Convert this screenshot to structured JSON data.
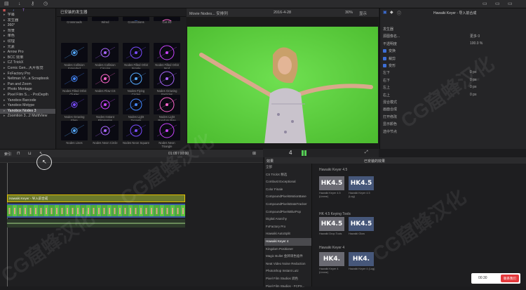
{
  "topbar": {
    "icons": [
      "bars-icon",
      "check-icon",
      "key-icon",
      "clock-icon"
    ],
    "right_icons": [
      "window-icon",
      "window-icon"
    ]
  },
  "sidebar": {
    "items": [
      {
        "pre": "",
        "label": "字幕"
      },
      {
        "pre": "",
        "label": "发生器"
      },
      {
        "pre": "",
        "label": "360°"
      },
      {
        "pre": "",
        "label": "背景"
      },
      {
        "pre": "",
        "label": "单色"
      },
      {
        "pre": "",
        "label": "纹理"
      },
      {
        "pre": "",
        "label": "元素"
      },
      {
        "pre": "",
        "label": "Arrow Pro"
      },
      {
        "pre": "",
        "label": "BCC 效果"
      },
      {
        "pre": "",
        "label": "CZ TrickX"
      },
      {
        "pre": "",
        "label": "Comic Gen...大片视觉"
      },
      {
        "pre": "",
        "label": "FxFactory Pro"
      },
      {
        "pre": "",
        "label": "Neltman VI...a Scrapbook"
      },
      {
        "pre": "",
        "label": "Pan and Zoom"
      },
      {
        "pre": "",
        "label": "Photo Montage"
      },
      {
        "pre": "",
        "label": "Pixel Film S... - ProDepth"
      },
      {
        "pre": "",
        "label": "Yanobox Barcode"
      },
      {
        "pre": "",
        "label": "Yanobox Motype"
      },
      {
        "pre": "",
        "label": "Yanobox Nodes 3"
      },
      {
        "pre": "",
        "label": "Zoomtion 3...2 MultiView"
      }
    ],
    "selected_index": 18
  },
  "browser": {
    "title": "已安装的发生器",
    "thumbs": [
      "Crossroads",
      "Wired",
      "Connections",
      "Cat 3D",
      "Nodes Collision Extended",
      "Nodes Collision Circular",
      "Nodes Filled Orbit Simple",
      "Nodes Filled Orbit Mod",
      "Nodes Filled Orbit Cluster",
      "Nodes Flow CS",
      "Nodes Flying Circles",
      "Nodes Growing Particles",
      "Nodes Growing Flare",
      "Nodes Instant Elimination",
      "Nodes Light Tunnels",
      "Nodes Light Random Rise",
      "Nodes Lines",
      "Nodes Neon Circle",
      "Nodes Neon Square",
      "Nodes Neon Triangle"
    ]
  },
  "viewer": {
    "title": "Movie Nodes... 安排列",
    "date": "2016-4-28",
    "zoom": "30%",
    "display": "显示"
  },
  "viewer_ctrl": {
    "timecode": "4"
  },
  "inspector": {
    "header": "Hawaiki Keyer - 导入前合成",
    "rows": [
      {
        "label": "发生器",
        "value": ""
      },
      {
        "label": "源图像名...",
        "value": "更多 0"
      },
      {
        "label": "不透明度",
        "value": "100.0 %"
      },
      {
        "label": "变换",
        "value": "",
        "checked": true
      },
      {
        "label": "裁剪",
        "value": "",
        "checked": true
      },
      {
        "label": "变形",
        "value": "",
        "checked": true
      },
      {
        "label": "左下",
        "value": "0 px"
      },
      {
        "label": "右下",
        "value": "0 px"
      },
      {
        "label": "左上",
        "value": "0 px"
      },
      {
        "label": "右上",
        "value": "0 px"
      },
      {
        "label": "混合模式",
        "value": ""
      },
      {
        "label": "画面合成",
        "value": ""
      },
      {
        "label": "打开修改",
        "value": ""
      },
      {
        "label": "显示颜色",
        "value": ""
      },
      {
        "label": "选中节点",
        "value": ""
      }
    ]
  },
  "timeline_bar": {
    "label": "索引",
    "timecode": "01:09 / 00:00"
  },
  "timeline": {
    "clip_title": "Hawaiki Keyer - 导入前合成",
    "clip_main": "夏日"
  },
  "fx": {
    "head_left": "效果",
    "head_center": "已安装的效果",
    "list": [
      "全部",
      "CS TrickX 精选",
      "Combust Exceptional",
      "Color Finale",
      "CompoundPixelsMotionBase",
      "CompoundPixelsDataTracker",
      "CompoundPixelsBlurPop",
      "Digital Anarchy",
      "FxFactory Pro",
      "Hawaiki AutoSplit",
      "Hawaiki Keyer 4",
      "Kingdom Positioner",
      "Magic Bullet 金牌调色插件",
      "Neat Video Noise Reduction",
      "PhotoShop Instant Lutz",
      "Pixel Film Studios 调色",
      "Pixel Film Studios - FCPX..."
    ],
    "selected_index": 10,
    "categories": [
      "Hawaiki Keyer 4.5",
      "HK 4.5 Keying Tools",
      "Hawaiki Keyer 4"
    ],
    "tiles": [
      {
        "text": "HK4.5",
        "label": "Hawaiki Keyer 4.5 (Linear)"
      },
      {
        "text": "HK4.5",
        "label": "Hawaiki Keyer 4.5 (Log)"
      },
      {
        "text": "HK4.5",
        "label": "Hawaiki Drop Tools"
      },
      {
        "text": "HK4.5",
        "label": "Hawaiki Glow"
      },
      {
        "text": "HK4.",
        "label": "Hawaiki Keyer 4 (Linear)"
      },
      {
        "text": "HK4.",
        "label": "Hawaiki Keyer 4 (Log)"
      }
    ]
  },
  "badge": {
    "time": "00:30",
    "button": "联系我们"
  },
  "watermark": "CG窟蜂汉化"
}
